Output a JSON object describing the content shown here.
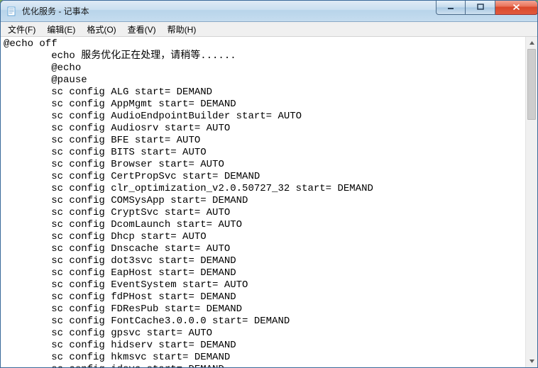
{
  "window": {
    "title": "优化服务 - 记事本"
  },
  "menubar": {
    "items": [
      {
        "label": "文件(F)"
      },
      {
        "label": "编辑(E)"
      },
      {
        "label": "格式(O)"
      },
      {
        "label": "查看(V)"
      },
      {
        "label": "帮助(H)"
      }
    ]
  },
  "content": {
    "lines": [
      "@echo off",
      "        echo 服务优化正在处理，请稍等......",
      "        @echo",
      "        @pause",
      "        sc config ALG start= DEMAND",
      "        sc config AppMgmt start= DEMAND",
      "        sc config AudioEndpointBuilder start= AUTO",
      "        sc config Audiosrv start= AUTO",
      "        sc config BFE start= AUTO",
      "        sc config BITS start= AUTO",
      "        sc config Browser start= AUTO",
      "        sc config CertPropSvc start= DEMAND",
      "        sc config clr_optimization_v2.0.50727_32 start= DEMAND",
      "        sc config COMSysApp start= DEMAND",
      "        sc config CryptSvc start= AUTO",
      "        sc config DcomLaunch start= AUTO",
      "        sc config Dhcp start= AUTO",
      "        sc config Dnscache start= AUTO",
      "        sc config dot3svc start= DEMAND",
      "        sc config EapHost start= DEMAND",
      "        sc config EventSystem start= AUTO",
      "        sc config fdPHost start= DEMAND",
      "        sc config FDResPub start= DEMAND",
      "        sc config FontCache3.0.0.0 start= DEMAND",
      "        sc config gpsvc start= AUTO",
      "        sc config hidserv start= DEMAND",
      "        sc config hkmsvc start= DEMAND",
      "        sc config idsvc start= DEMAND"
    ]
  }
}
